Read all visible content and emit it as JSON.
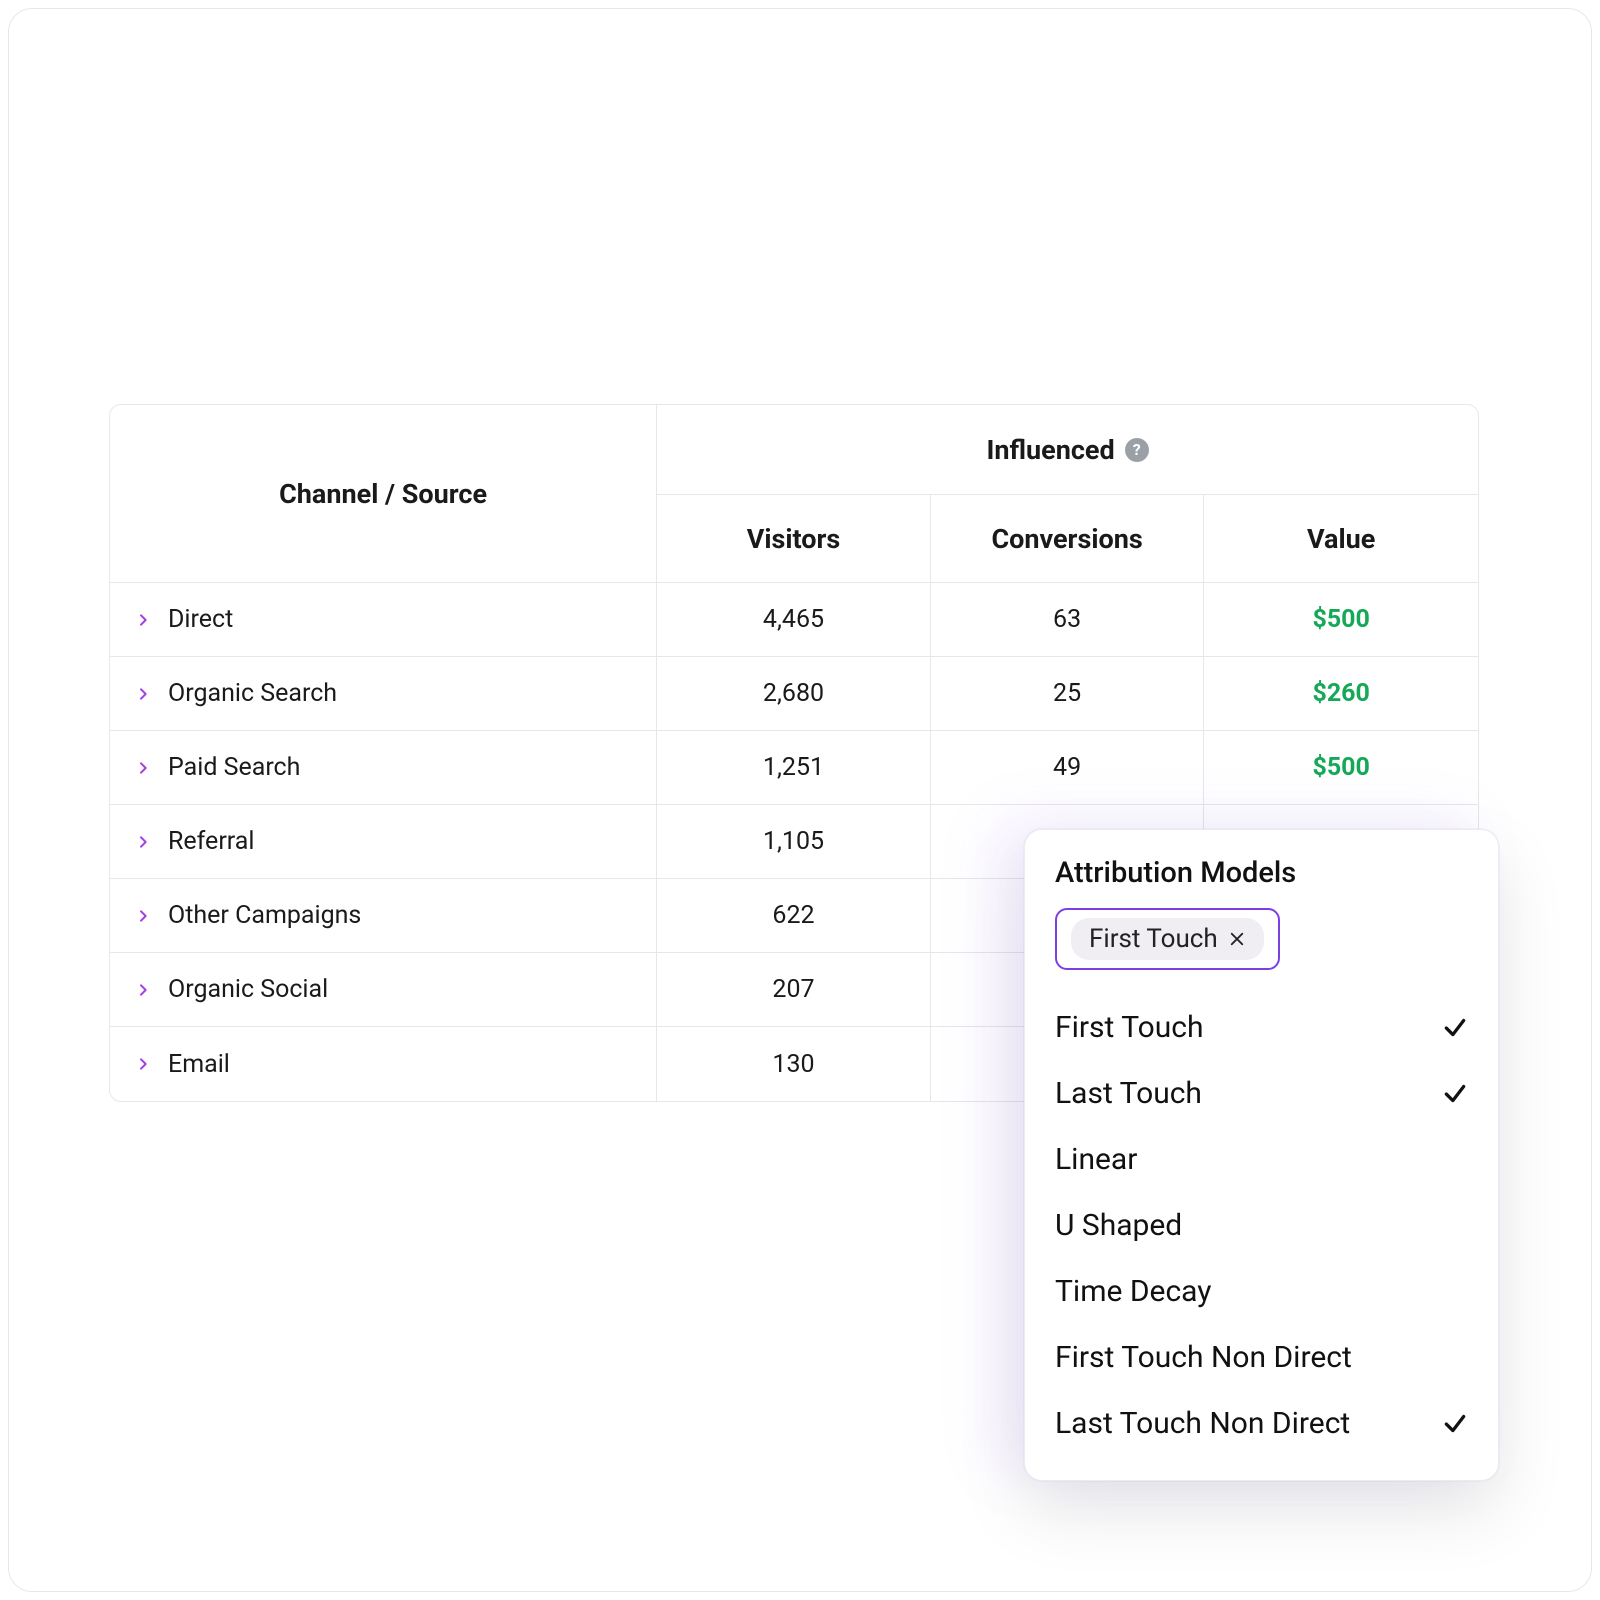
{
  "table": {
    "group_header": "Influenced",
    "columns": {
      "channel": "Channel / Source",
      "visitors": "Visitors",
      "conversions": "Conversions",
      "value": "Value"
    },
    "rows": [
      {
        "channel": "Direct",
        "visitors": "4,465",
        "conversions": "63",
        "value": "$500"
      },
      {
        "channel": "Organic Search",
        "visitors": "2,680",
        "conversions": "25",
        "value": "$260"
      },
      {
        "channel": "Paid Search",
        "visitors": "1,251",
        "conversions": "49",
        "value": "$500"
      },
      {
        "channel": "Referral",
        "visitors": "1,105",
        "conversions": "",
        "value": ""
      },
      {
        "channel": "Other Campaigns",
        "visitors": "622",
        "conversions": "",
        "value": ""
      },
      {
        "channel": "Organic Social",
        "visitors": "207",
        "conversions": "",
        "value": ""
      },
      {
        "channel": "Email",
        "visitors": "130",
        "conversions": "",
        "value": ""
      }
    ]
  },
  "popover": {
    "title": "Attribution Models",
    "selected_chip": "First Touch",
    "options": [
      {
        "label": "First Touch",
        "checked": true
      },
      {
        "label": "Last Touch",
        "checked": true
      },
      {
        "label": "Linear",
        "checked": false
      },
      {
        "label": "U Shaped",
        "checked": false
      },
      {
        "label": "Time Decay",
        "checked": false
      },
      {
        "label": "First Touch Non Direct",
        "checked": false
      },
      {
        "label": "Last Touch Non Direct",
        "checked": true
      }
    ]
  },
  "icons": {
    "help_glyph": "?"
  }
}
